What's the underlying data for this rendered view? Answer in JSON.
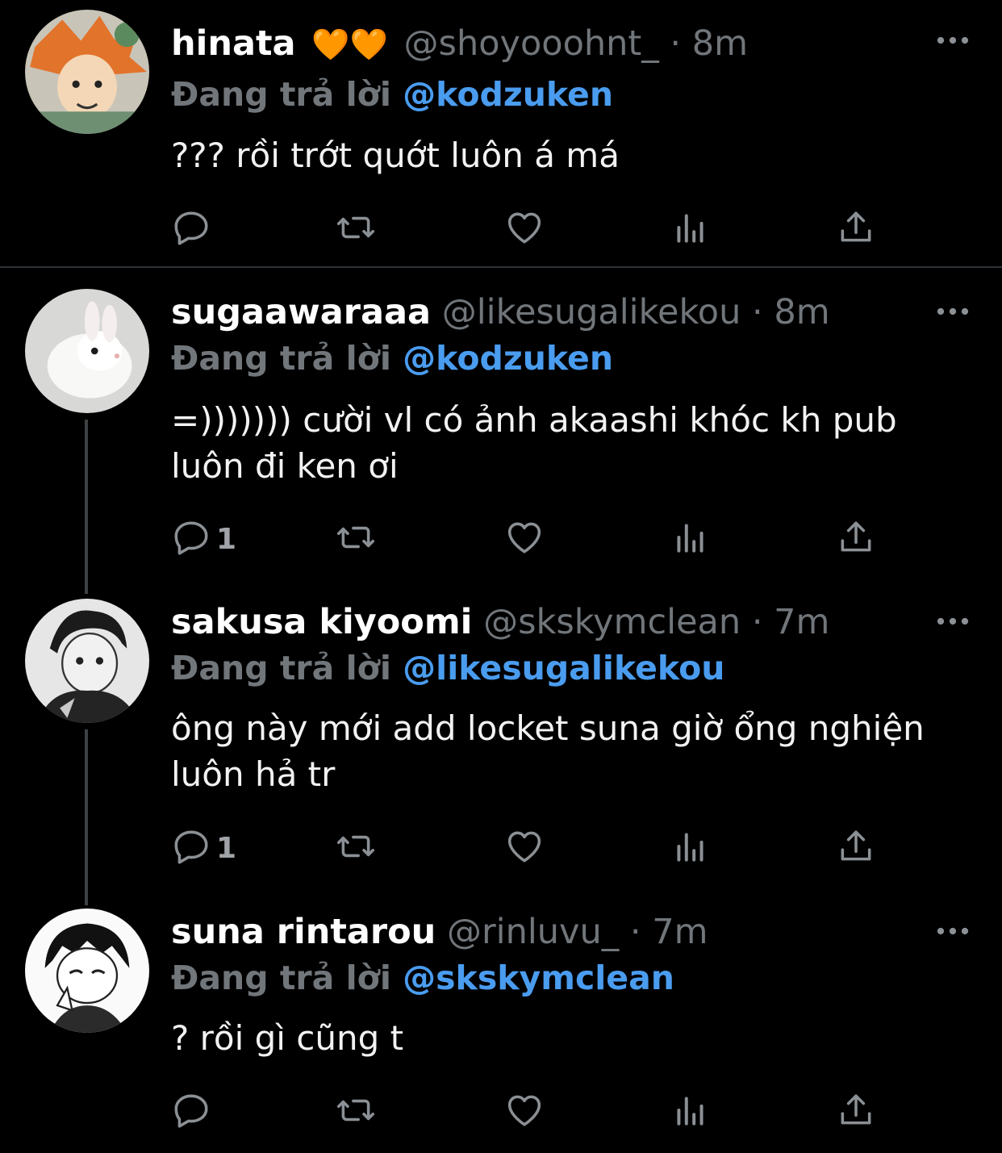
{
  "colors": {
    "background": "#000000",
    "mention": "#4a9cef",
    "muted": "#71767b",
    "divider": "#2f3336"
  },
  "tweets": [
    {
      "name": "hinata",
      "name_emoji": "🧡🧡",
      "handle": "@shoyooohnt_",
      "separator": "·",
      "time": "8m",
      "reply_label": "Đang trả lời",
      "reply_to": "@kodzuken",
      "text": "??? rồi trớt quớt luôn á má",
      "reply_count": "",
      "avatar_icon": "hinata-avatar"
    },
    {
      "name": "sugaawaraaa",
      "handle": "@likesugalikekou",
      "separator": "·",
      "time": "8m",
      "reply_label": "Đang trả lời",
      "reply_to": "@kodzuken",
      "text": "=))))))) cười vl có ảnh akaashi khóc kh pub luôn đi ken ơi",
      "reply_count": "1",
      "avatar_icon": "white-rabbit-avatar"
    },
    {
      "name": "sakusa kiyoomi",
      "handle": "@skskymclean",
      "separator": "·",
      "time": "7m",
      "reply_label": "Đang trả lời",
      "reply_to": "@likesugalikekou",
      "text": "ông này mới add locket suna giờ ổng nghiện luôn hả tr",
      "reply_count": "1",
      "avatar_icon": "sakusa-avatar"
    },
    {
      "name": "suna rintarou",
      "handle": "@rinluvu_",
      "separator": "·",
      "time": "7m",
      "reply_label": "Đang trả lời",
      "reply_to": "@skskymclean",
      "text": "? rồi gì cũng t",
      "reply_count": "",
      "avatar_icon": "suna-avatar"
    }
  ],
  "action_icons": [
    "reply-icon",
    "retweet-icon",
    "like-icon",
    "views-icon",
    "share-icon"
  ],
  "more_icon": "more-options-icon"
}
